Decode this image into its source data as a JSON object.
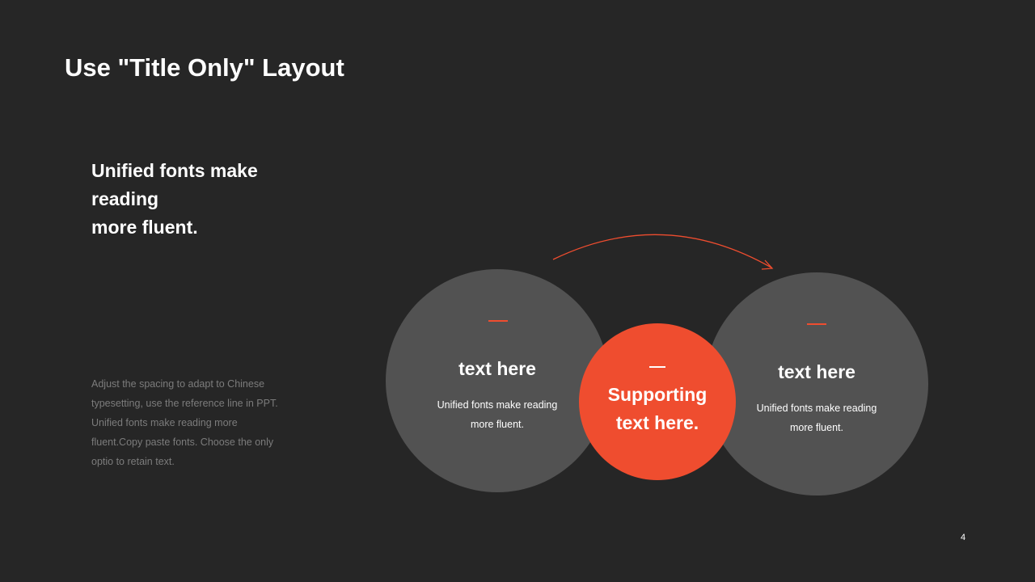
{
  "slide": {
    "title": "Use \"Title Only\" Layout",
    "subtitle_lines": [
      "Unified fonts make",
      "reading",
      "more fluent."
    ],
    "body_lines": [
      "Adjust the spacing to adapt to Chinese",
      "typesetting, use the reference line  in PPT.",
      "Unified  fonts make reading more",
      "fluent.Copy paste fonts. Choose the only",
      "optio to retain text."
    ],
    "page_number": "4"
  },
  "diagram": {
    "left": {
      "heading": "text here",
      "text_lines": [
        "Unified  fonts make reading",
        "more fluent."
      ]
    },
    "center": {
      "text_lines": [
        "Supporting",
        "text here."
      ]
    },
    "right": {
      "heading": "text here",
      "text_lines": [
        "Unified  fonts make reading",
        "more fluent."
      ]
    }
  },
  "colors": {
    "background": "#262626",
    "accent": "#ef4d2f",
    "circle": "#525252",
    "muted_text": "#7c7c7c"
  }
}
